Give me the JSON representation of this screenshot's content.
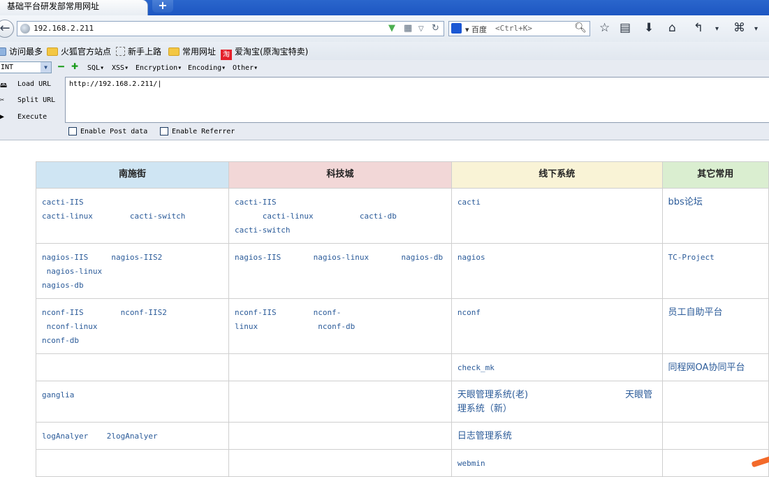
{
  "browser": {
    "tab_title": "基础平台研发部常用网址",
    "new_tab": "+",
    "url": "192.168.2.211",
    "search_engine": "百度",
    "search_shortcut": "<Ctrl+K>"
  },
  "bookmarks": [
    "访问最多",
    "火狐官方站点",
    "新手上路",
    "常用网址",
    "爱淘宝(原淘宝特卖)"
  ],
  "hackbar": {
    "select_value": "INT",
    "menus": [
      "SQL",
      "XSS",
      "Encryption",
      "Encoding",
      "Other"
    ],
    "load_url": "Load URL",
    "split_url": "Split URL",
    "execute": "Execute",
    "url_value": "http://192.168.2.211/",
    "enable_post": "Enable Post data",
    "enable_referrer": "Enable Referrer"
  },
  "table": {
    "headers": [
      "南施街",
      "科技城",
      "线下系统",
      "其它常用"
    ],
    "header_colors": [
      "#cfe5f3",
      "#f2d7d7",
      "#f9f3d6",
      "#daeed0"
    ],
    "rows": [
      [
        [
          "cacti-IIS",
          "cacti-linux",
          "cacti-switch"
        ],
        [
          "cacti-IIS",
          "cacti-linux",
          "cacti-db",
          "cacti-switch"
        ],
        [
          "cacti"
        ],
        [
          "bbs论坛"
        ]
      ],
      [
        [
          "nagios-IIS",
          "nagios-IIS2",
          "nagios-linux",
          "nagios-db"
        ],
        [
          "nagios-IIS",
          "nagios-linux",
          "nagios-db"
        ],
        [
          "nagios"
        ],
        [
          "TC-Project"
        ]
      ],
      [
        [
          "nconf-IIS",
          "nconf-IIS2",
          "nconf-linux",
          "nconf-db"
        ],
        [
          "nconf-IIS",
          "nconf-linux",
          "nconf-db"
        ],
        [
          "nconf"
        ],
        [
          "员工自助平台"
        ]
      ],
      [
        [],
        [],
        [
          "check_mk"
        ],
        [
          "同程网OA协同平台"
        ]
      ],
      [
        [
          "ganglia"
        ],
        [],
        [
          "天眼管理系统(老)",
          "天眼管理系统（新）"
        ],
        []
      ],
      [
        [
          "logAnalyer",
          "2logAnalyer"
        ],
        [],
        [
          "日志管理系统"
        ],
        []
      ],
      [
        [],
        [],
        [
          "webmin"
        ],
        []
      ]
    ]
  }
}
